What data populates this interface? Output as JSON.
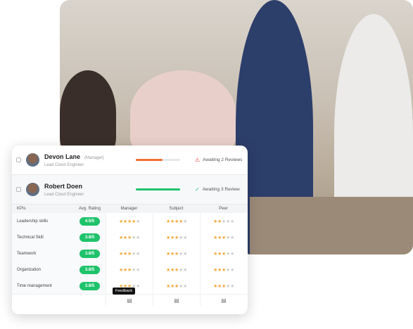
{
  "people": [
    {
      "name": "Devon Lane",
      "role": "(Manager)",
      "title": "Lead Cloud Engineer",
      "progress": 0.6,
      "bar_color": "#f07030",
      "status": "Awaiting 2 Reviews",
      "status_icon": "warning-icon"
    },
    {
      "name": "Robert Doen",
      "role": "",
      "title": "Lead Cloud Engineer",
      "progress": 1.0,
      "bar_color": "#1ec36b",
      "status": "Awaiting 3 Review",
      "status_icon": "check-icon"
    }
  ],
  "table": {
    "headers": [
      "KPIs",
      "Avg. Rating",
      "Manager",
      "Subject",
      "Peer"
    ],
    "rows": [
      {
        "kpi": "Leadership skills",
        "avg": "4.5/5",
        "manager": 4,
        "subject": 4,
        "peer": 2
      },
      {
        "kpi": "Technical Skill",
        "avg": "3.8/5",
        "manager": 3,
        "subject": 3,
        "peer": 3
      },
      {
        "kpi": "Teamwork",
        "avg": "3.8/5",
        "manager": 3,
        "subject": 3,
        "peer": 3
      },
      {
        "kpi": "Organization",
        "avg": "3.8/5",
        "manager": 3,
        "subject": 3,
        "peer": 3
      },
      {
        "kpi": "Time management",
        "avg": "3.8/5",
        "manager": 3,
        "subject": 3,
        "peer": 3
      }
    ],
    "max_stars": 5
  },
  "tooltip": "Feedback"
}
